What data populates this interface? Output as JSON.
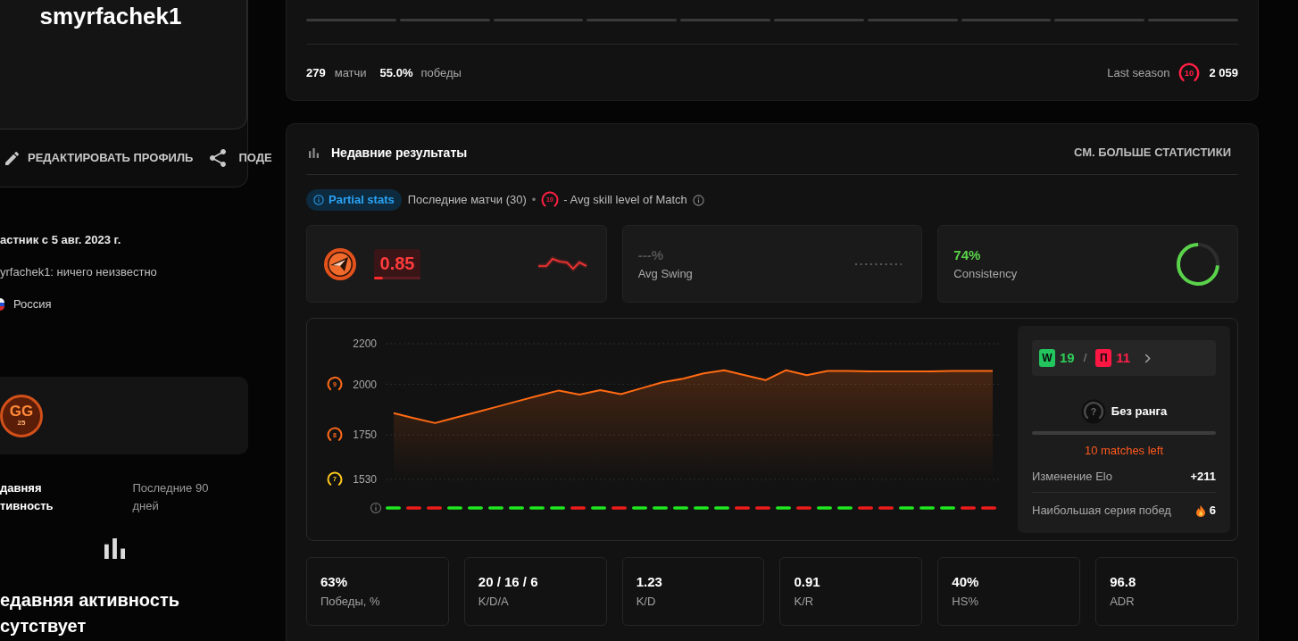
{
  "profile": {
    "username": "smyrfachek1",
    "actions": [
      {
        "kind": "edit",
        "label": "РЕДАКТИРОВАТЬ ПРОФИЛЬ"
      },
      {
        "kind": "share",
        "label": "ПОДЕ"
      }
    ]
  },
  "about": {
    "member_since": "астник с 5 авг. 2023 г.",
    "bio": "yrfachek1: ничего неизвестно",
    "country": "Россия"
  },
  "badges": [
    {
      "title": "GG",
      "number": "25"
    }
  ],
  "activity": {
    "title_lines": [
      "давняя",
      "тивность"
    ],
    "period": "Последние 90 дней",
    "empty_lines": [
      "едавняя активность",
      "сутствует"
    ]
  },
  "season": {
    "segments": [
      {
        "filled": false
      },
      {
        "filled": false
      },
      {
        "filled": false
      },
      {
        "filled": false
      },
      {
        "filled": false
      },
      {
        "filled": false
      },
      {
        "filled": false
      },
      {
        "filled": false
      },
      {
        "filled": false
      },
      {
        "filled": false
      }
    ],
    "matches": "279",
    "matches_label": "матчи",
    "winrate": "55.0%",
    "winrate_label": "победы",
    "last_season_label": "Last season",
    "last_season_level": "10",
    "last_season_elo": "2 059"
  },
  "recent": {
    "title": "Недавние результаты",
    "more_link": "СМ. БОЛЬШЕ СТАТИСТИКИ",
    "partial_label": "Partial stats",
    "matches_note": "Последние матчи (30)",
    "separator": "•",
    "avg_level": "10",
    "avg_level_note": "- Avg skill level of Match",
    "highlights": [
      {
        "kind": "rating",
        "value": "0.85",
        "level": 0.2
      },
      {
        "kind": "swing",
        "value": "---%",
        "label": "Avg Swing"
      },
      {
        "kind": "consistency",
        "value": "74%",
        "label": "Consistency",
        "level": 0.74
      }
    ],
    "chart": {
      "chart_data": {
        "type": "area",
        "ylim": [
          1530,
          2200
        ],
        "yticks": [
          1530,
          1750,
          2000,
          2200
        ],
        "series": [
          {
            "color": "#ff6a13",
            "values": [
              1857,
              1832,
              1808,
              1835,
              1862,
              1889,
              1916,
              1943,
              1969,
              1949,
              1971,
              1951,
              1980,
              2009,
              2027,
              2053,
              2069,
              2045,
              2020,
              2069,
              2045,
              2065,
              2065,
              2064,
              2064,
              2063,
              2064,
              2065,
              2066,
              2065
            ]
          }
        ]
      },
      "tick_badges": [
        {
          "label": "9",
          "color": "#ff6b1a"
        },
        {
          "label": "8",
          "color": "#ff6b1a"
        },
        {
          "label": "7",
          "color": "#ffc91a"
        }
      ],
      "results": [
        {
          "win": true
        },
        {
          "win": false
        },
        {
          "win": false
        },
        {
          "win": true
        },
        {
          "win": true
        },
        {
          "win": true
        },
        {
          "win": true
        },
        {
          "win": true
        },
        {
          "win": true
        },
        {
          "win": false
        },
        {
          "win": true
        },
        {
          "win": false
        },
        {
          "win": true
        },
        {
          "win": true
        },
        {
          "win": true
        },
        {
          "win": true
        },
        {
          "win": true
        },
        {
          "win": false
        },
        {
          "win": false
        },
        {
          "win": true
        },
        {
          "win": false
        },
        {
          "win": true
        },
        {
          "win": true
        },
        {
          "win": false
        },
        {
          "win": false
        },
        {
          "win": true
        },
        {
          "win": true
        },
        {
          "win": true
        },
        {
          "win": false
        },
        {
          "win": false
        }
      ]
    },
    "summary": {
      "win_tag": "W",
      "wins": "19",
      "separator": "/",
      "loss_tag": "П",
      "losses": "11",
      "rank_icon": "?",
      "rank": "Без ранга",
      "matches_left": "10 matches left",
      "rows": [
        {
          "kind": "elo",
          "label": "Изменение Elo",
          "value": "+211"
        },
        {
          "kind": "streak",
          "label": "Наибольшая серия побед",
          "value": "6"
        }
      ]
    },
    "stats": [
      {
        "value": "63%",
        "label": "Победы, %"
      },
      {
        "value": "20 / 16 / 6",
        "label": "K/D/A"
      },
      {
        "value": "1.23",
        "label": "K/D"
      },
      {
        "value": "0.91",
        "label": "K/R"
      },
      {
        "value": "40%",
        "label": "HS%"
      },
      {
        "value": "96.8",
        "label": "ADR"
      }
    ]
  }
}
